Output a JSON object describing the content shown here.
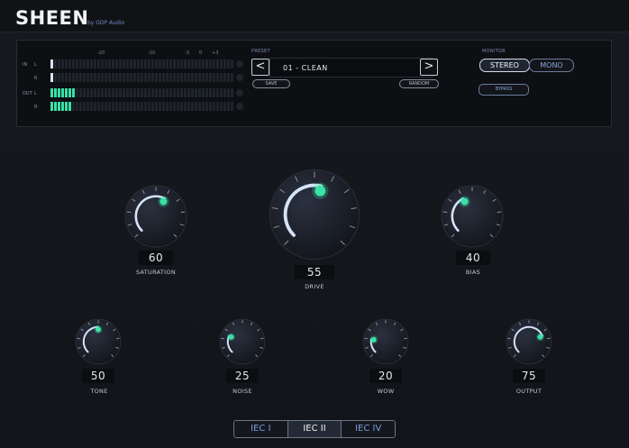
{
  "header": {
    "brand": "SHEEN",
    "byline": "by GDP Audio"
  },
  "meters": {
    "scale_labels": [
      "-20",
      "-10",
      "-3",
      "0",
      "+3"
    ],
    "channels": [
      {
        "group": "IN",
        "side": "L",
        "lit": 1,
        "style": "low"
      },
      {
        "group": "",
        "side": "R",
        "lit": 1,
        "style": "low"
      },
      {
        "group": "OUT",
        "side": "L",
        "lit": 7,
        "style": "on"
      },
      {
        "group": "",
        "side": "R",
        "lit": 6,
        "style": "on"
      }
    ]
  },
  "preset": {
    "label": "PRESET",
    "prev": "<",
    "next": ">",
    "name": "01  -  CLEAN",
    "save": "SAVE",
    "random": "RANDOM"
  },
  "monitor": {
    "label": "MONITOR",
    "stereo": "STEREO",
    "mono": "MONO",
    "bypass": "BYPASS",
    "selected": "STEREO"
  },
  "knobs": {
    "saturation": {
      "label": "SATURATION",
      "value": "60"
    },
    "drive": {
      "label": "DRIVE",
      "value": "55"
    },
    "bias": {
      "label": "BIAS",
      "value": "40"
    },
    "tone": {
      "label": "TONE",
      "value": "50"
    },
    "noise": {
      "label": "NOISE",
      "value": "25"
    },
    "wow": {
      "label": "WOW",
      "value": "20"
    },
    "output": {
      "label": "OUTPUT",
      "value": "75"
    }
  },
  "tabs": {
    "items": [
      "IEC I",
      "IEC II",
      "IEC IV"
    ],
    "active": "IEC II"
  },
  "colors": {
    "accent": "#38e2a6",
    "arc": "#d5e3f7",
    "link": "#7f9be0"
  }
}
